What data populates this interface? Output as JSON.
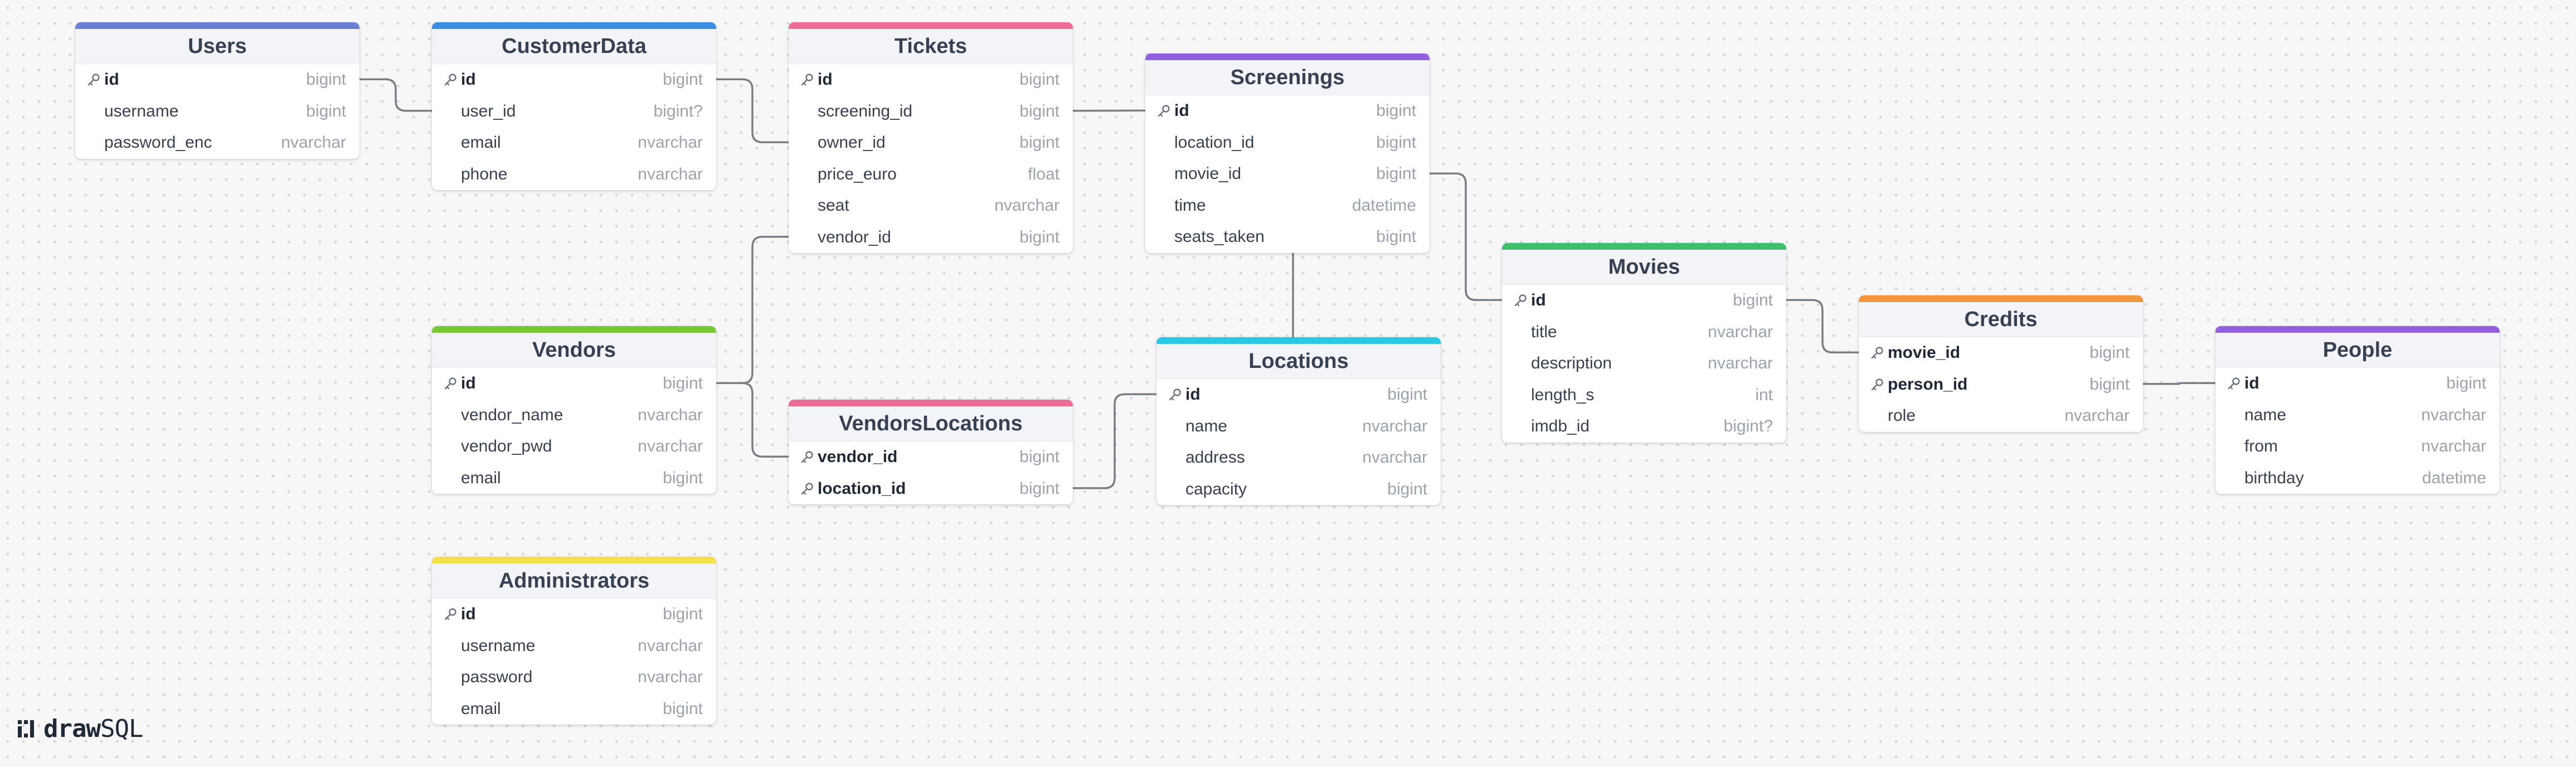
{
  "app": {
    "brand_bold": "draw",
    "brand_rest": "SQL"
  },
  "tables": {
    "users": {
      "title": "Users",
      "color": "#6b7fd7",
      "columns": [
        {
          "name": "id",
          "type": "bigint",
          "pk": true
        },
        {
          "name": "username",
          "type": "bigint",
          "pk": false
        },
        {
          "name": "password_enc",
          "type": "nvarchar",
          "pk": false
        }
      ]
    },
    "customer_data": {
      "title": "CustomerData",
      "color": "#3b8fe0",
      "columns": [
        {
          "name": "id",
          "type": "bigint",
          "pk": true
        },
        {
          "name": "user_id",
          "type": "bigint?",
          "pk": false
        },
        {
          "name": "email",
          "type": "nvarchar",
          "pk": false
        },
        {
          "name": "phone",
          "type": "nvarchar",
          "pk": false
        }
      ]
    },
    "tickets": {
      "title": "Tickets",
      "color": "#ee6b95",
      "columns": [
        {
          "name": "id",
          "type": "bigint",
          "pk": true
        },
        {
          "name": "screening_id",
          "type": "bigint",
          "pk": false
        },
        {
          "name": "owner_id",
          "type": "bigint",
          "pk": false
        },
        {
          "name": "price_euro",
          "type": "float",
          "pk": false
        },
        {
          "name": "seat",
          "type": "nvarchar",
          "pk": false
        },
        {
          "name": "vendor_id",
          "type": "bigint",
          "pk": false
        }
      ]
    },
    "screenings": {
      "title": "Screenings",
      "color": "#9160dd",
      "columns": [
        {
          "name": "id",
          "type": "bigint",
          "pk": true
        },
        {
          "name": "location_id",
          "type": "bigint",
          "pk": false
        },
        {
          "name": "movie_id",
          "type": "bigint",
          "pk": false
        },
        {
          "name": "time",
          "type": "datetime",
          "pk": false
        },
        {
          "name": "seats_taken",
          "type": "bigint",
          "pk": false
        }
      ]
    },
    "vendors": {
      "title": "Vendors",
      "color": "#78c83a",
      "columns": [
        {
          "name": "id",
          "type": "bigint",
          "pk": true
        },
        {
          "name": "vendor_name",
          "type": "nvarchar",
          "pk": false
        },
        {
          "name": "vendor_pwd",
          "type": "nvarchar",
          "pk": false
        },
        {
          "name": "email",
          "type": "bigint",
          "pk": false
        }
      ]
    },
    "vendors_locations": {
      "title": "VendorsLocations",
      "color": "#ee6b95",
      "columns": [
        {
          "name": "vendor_id",
          "type": "bigint",
          "pk": true
        },
        {
          "name": "location_id",
          "type": "bigint",
          "pk": true
        }
      ]
    },
    "locations": {
      "title": "Locations",
      "color": "#2bc8e6",
      "columns": [
        {
          "name": "id",
          "type": "bigint",
          "pk": true
        },
        {
          "name": "name",
          "type": "nvarchar",
          "pk": false
        },
        {
          "name": "address",
          "type": "nvarchar",
          "pk": false
        },
        {
          "name": "capacity",
          "type": "bigint",
          "pk": false
        }
      ]
    },
    "movies": {
      "title": "Movies",
      "color": "#3fbf6a",
      "columns": [
        {
          "name": "id",
          "type": "bigint",
          "pk": true
        },
        {
          "name": "title",
          "type": "nvarchar",
          "pk": false
        },
        {
          "name": "description",
          "type": "nvarchar",
          "pk": false
        },
        {
          "name": "length_s",
          "type": "int",
          "pk": false
        },
        {
          "name": "imdb_id",
          "type": "bigint?",
          "pk": false
        }
      ]
    },
    "credits": {
      "title": "Credits",
      "color": "#f2963c",
      "columns": [
        {
          "name": "movie_id",
          "type": "bigint",
          "pk": true
        },
        {
          "name": "person_id",
          "type": "bigint",
          "pk": true
        },
        {
          "name": "role",
          "type": "nvarchar",
          "pk": false
        }
      ]
    },
    "people": {
      "title": "People",
      "color": "#9160dd",
      "columns": [
        {
          "name": "id",
          "type": "bigint",
          "pk": true
        },
        {
          "name": "name",
          "type": "nvarchar",
          "pk": false
        },
        {
          "name": "from",
          "type": "nvarchar",
          "pk": false
        },
        {
          "name": "birthday",
          "type": "datetime",
          "pk": false
        }
      ]
    },
    "administrators": {
      "title": "Administrators",
      "color": "#f5e04a",
      "columns": [
        {
          "name": "id",
          "type": "bigint",
          "pk": true
        },
        {
          "name": "username",
          "type": "nvarchar",
          "pk": false
        },
        {
          "name": "password",
          "type": "nvarchar",
          "pk": false
        },
        {
          "name": "email",
          "type": "bigint",
          "pk": false
        }
      ]
    }
  },
  "relationships": [
    {
      "from": "users.id",
      "to": "customer_data.user_id"
    },
    {
      "from": "customer_data.id",
      "to": "tickets.owner_id"
    },
    {
      "from": "tickets.screening_id",
      "to": "screenings.id"
    },
    {
      "from": "vendors.id",
      "to": "tickets.vendor_id"
    },
    {
      "from": "vendors.id",
      "to": "vendors_locations.vendor_id"
    },
    {
      "from": "vendors_locations.location_id",
      "to": "locations.id"
    },
    {
      "from": "screenings.location_id",
      "to": "locations.id"
    },
    {
      "from": "screenings.movie_id",
      "to": "movies.id"
    },
    {
      "from": "movies.id",
      "to": "credits.movie_id"
    },
    {
      "from": "credits.person_id",
      "to": "people.id"
    }
  ]
}
